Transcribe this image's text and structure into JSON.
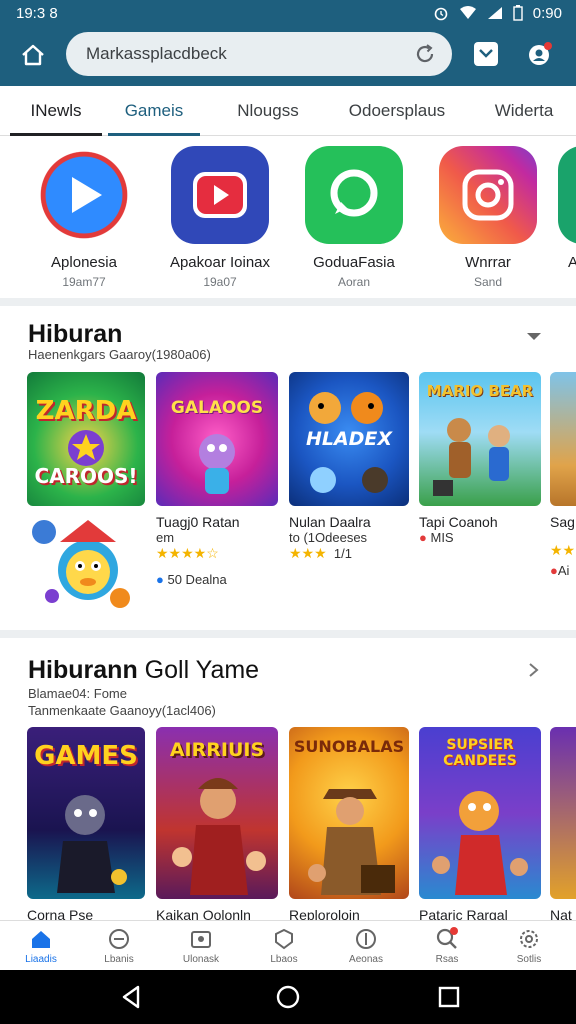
{
  "status_bar": {
    "time_left": "19:3 8",
    "time_right": "0:90"
  },
  "search": {
    "text": "Markassplacdbeck"
  },
  "tabs": [
    {
      "label": "INewls"
    },
    {
      "label": "Gameis"
    },
    {
      "label": "Nlougss"
    },
    {
      "label": "Odoersplaus"
    },
    {
      "label": "Widerta"
    }
  ],
  "featured_apps": [
    {
      "name": "Aplonesia",
      "sub": "19am77",
      "icon": "play-icon",
      "color": "#1d6fe0"
    },
    {
      "name": "Apakoar Ioinax",
      "sub": "19a07",
      "icon": "video-icon",
      "color": "#3048b8"
    },
    {
      "name": "GoduaFasia",
      "sub": "Aoran",
      "icon": "chat-icon",
      "color": "#25c05a"
    },
    {
      "name": "Wnrrar",
      "sub": "Sand",
      "icon": "camera-icon",
      "color": "#e8458a"
    },
    {
      "name": "A",
      "sub": "",
      "icon": "app-icon",
      "color": "#1aa36b"
    }
  ],
  "section1": {
    "title": "Hiburan",
    "subtitle": "Haenenkgars Gaaroy(1980a06)",
    "cards": [
      {
        "art": "ZARDA CAROOS!",
        "name": "",
        "line2": "",
        "rating": "",
        "extra": "",
        "colors": [
          "#1ba346",
          "#f2c12e"
        ]
      },
      {
        "art": "GALAOOS",
        "name": "Tuagj0 Ratan",
        "line2": "em",
        "rating": "★★★★☆",
        "extra": "50 Dealna",
        "colors": [
          "#d81b8c",
          "#7b2fd0"
        ]
      },
      {
        "art": "HLADEX",
        "name": "Nulan Daalra",
        "line2": "to        (1Odeeses",
        "rating": "★★★",
        "extra": "1/1",
        "colors": [
          "#1a5fc6",
          "#0b3a88"
        ]
      },
      {
        "art": "MARIO BEAR",
        "name": "Tapi Coanoh",
        "line2": "MIS",
        "rating": "",
        "extra": "",
        "colors": [
          "#36a3d9",
          "#a36a2e"
        ]
      },
      {
        "art": "",
        "name": "Sag",
        "line2": "",
        "rating": "★★",
        "extra": "Ai",
        "colors": [
          "#e0a34a",
          "#7fc3e8"
        ]
      }
    ]
  },
  "section2": {
    "title_bold": "Hiburann",
    "title_rest": "Goll Yame",
    "line1": "Blamae04:  Fome",
    "subtitle": "Tanmenkaate Gaanoyy(1acl406)",
    "cards": [
      {
        "art": "GAMES",
        "name": "Corna Pse",
        "colors": [
          "#2a1a5e",
          "#0d6a8a"
        ]
      },
      {
        "art": "AIRRIUIS",
        "name": "Kaikan Oolonln",
        "colors": [
          "#7a1f8c",
          "#d2452f"
        ]
      },
      {
        "art": "SUNOBALAS",
        "name": "Reploroloin",
        "colors": [
          "#f2a21b",
          "#b0461a"
        ]
      },
      {
        "art": "SUPSIER CANDEES",
        "name": "Pataric Rargal",
        "colors": [
          "#5a3fd0",
          "#d23a8f"
        ]
      },
      {
        "art": "",
        "name": "Nat",
        "colors": [
          "#6a2fb0",
          "#e2a12a"
        ]
      }
    ]
  },
  "bottom_nav": [
    {
      "label": "Liaadis",
      "icon": "home-icon"
    },
    {
      "label": "Lbanis",
      "icon": "games-icon"
    },
    {
      "label": "Ulonask",
      "icon": "apps-icon"
    },
    {
      "label": "Lbaos",
      "icon": "movies-icon"
    },
    {
      "label": "Aeonas",
      "icon": "books-icon"
    },
    {
      "label": "Rsas",
      "icon": "search-icon"
    },
    {
      "label": "Sotlis",
      "icon": "settings-icon"
    }
  ]
}
